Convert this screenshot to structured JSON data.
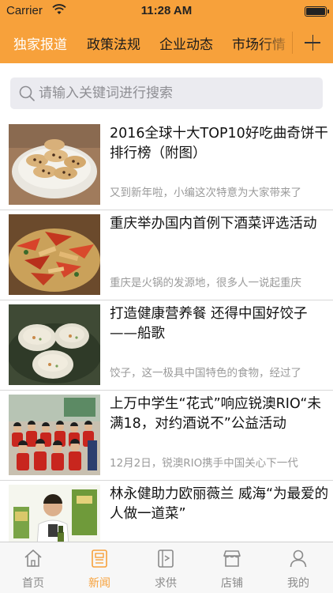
{
  "status_bar": {
    "carrier": "Carrier",
    "time": "11:28 AM"
  },
  "top_tabs": {
    "items": [
      {
        "label": "独家报道",
        "active": true
      },
      {
        "label": "政策法规",
        "active": false
      },
      {
        "label": "企业动态",
        "active": false
      },
      {
        "label": "市场行情",
        "active": false
      }
    ],
    "add_icon": "plus-icon"
  },
  "search": {
    "placeholder": "请输入关键词进行搜索",
    "icon": "search-icon"
  },
  "news": [
    {
      "title": "2016全球十大TOP10好吃曲奇饼干排行榜（附图）",
      "summary": "又到新年啦，小编这次特意为大家带来了",
      "image": "cookies-photo"
    },
    {
      "title": "重庆举办国内首例下酒菜评选活动",
      "summary": "重庆是火锅的发源地，很多人一说起重庆",
      "image": "spicy-dish-photo"
    },
    {
      "title": "打造健康营养餐 还得中国好饺子——船歌",
      "summary": "饺子，这一极具中国特色的食物，经过了",
      "image": "dumplings-photo"
    },
    {
      "title": "上万中学生“花式”响应锐澳RIO“未满18，对约酒说不”公益活动",
      "summary": "12月2日，锐澳RIO携手中国关心下一代",
      "image": "students-photo"
    },
    {
      "title": "林永健助力欧丽薇兰 威海“为最爱的人做一道菜”",
      "summary": "",
      "image": "chef-olive-oil-photo"
    }
  ],
  "tab_bar": {
    "items": [
      {
        "label": "首页",
        "icon": "home-icon",
        "active": false
      },
      {
        "label": "新闻",
        "icon": "newspaper-icon",
        "active": true
      },
      {
        "label": "求供",
        "icon": "supply-demand-icon",
        "active": false
      },
      {
        "label": "店铺",
        "icon": "store-icon",
        "active": false
      },
      {
        "label": "我的",
        "icon": "user-icon",
        "active": false
      }
    ]
  },
  "colors": {
    "accent": "#f7a13b",
    "active_tab_text": "#ffffff",
    "tab_bar_inactive": "#8a8a8a"
  }
}
